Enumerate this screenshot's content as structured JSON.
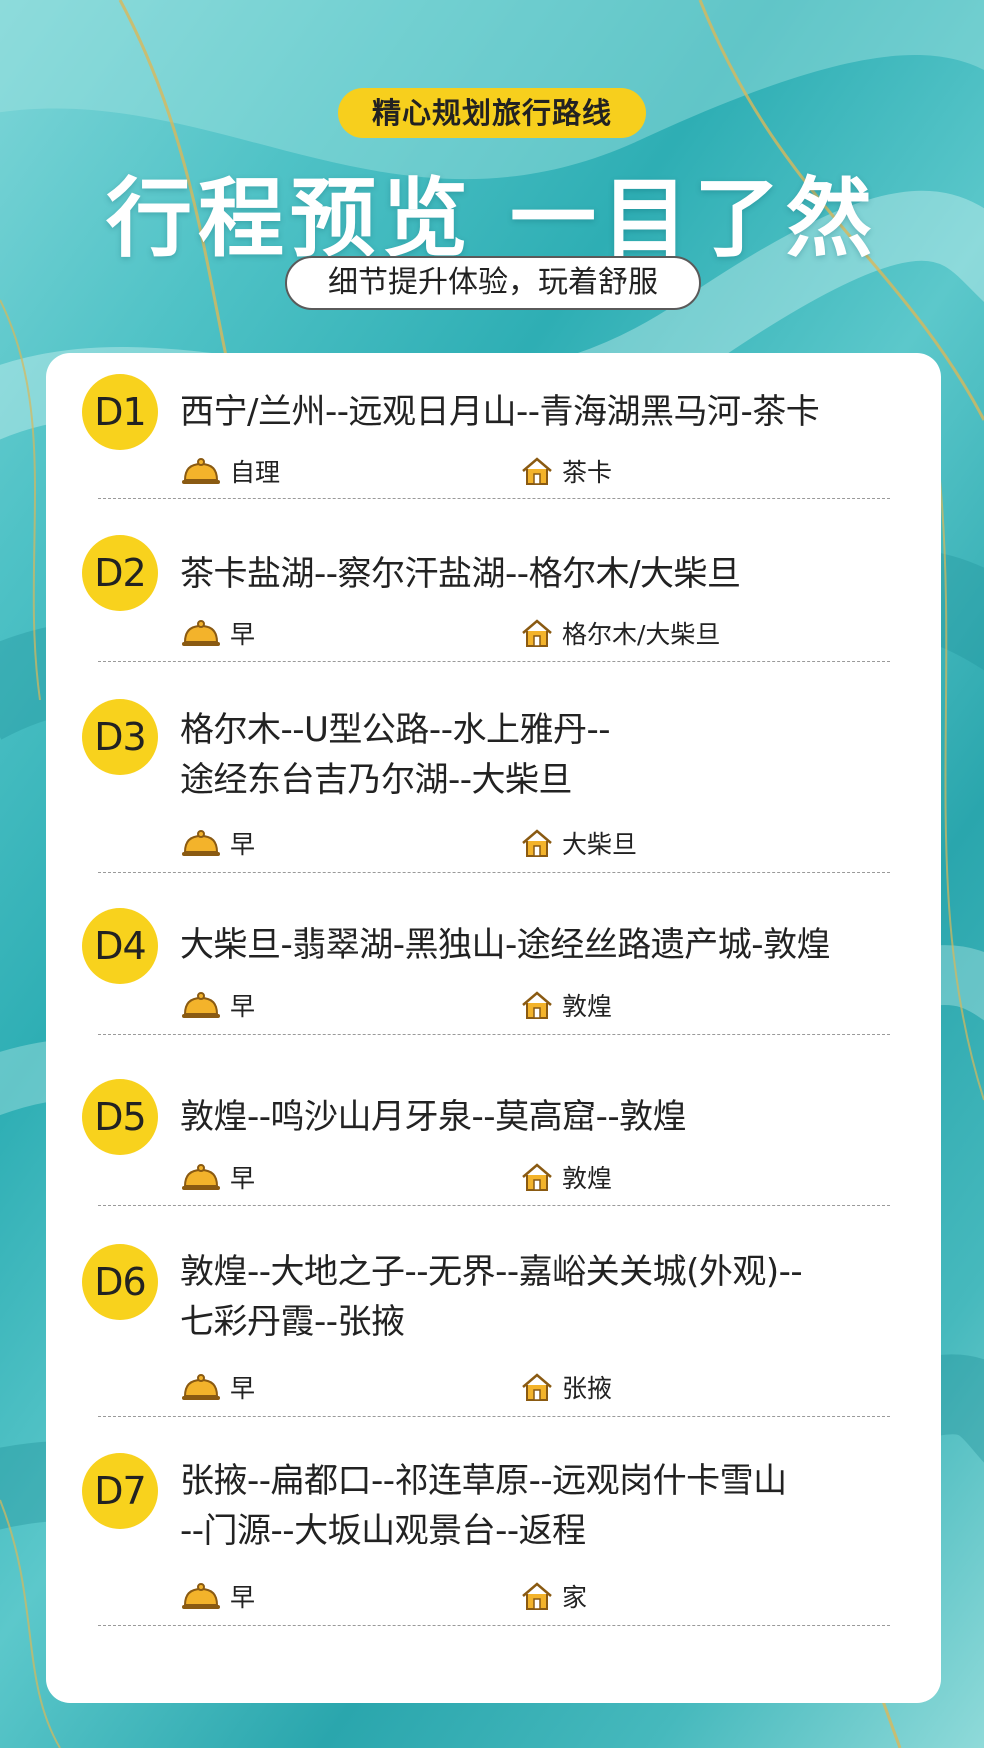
{
  "header": {
    "badge": "精心规划旅行路线",
    "headline": "行程预览 一目了然",
    "subtitle": "细节提升体验，玩着舒服"
  },
  "days": [
    {
      "label": "D1",
      "route": "西宁/兰州--远观日月山--青海湖黑马河-茶卡",
      "meal": "自理",
      "hotel": "茶卡"
    },
    {
      "label": "D2",
      "route": "茶卡盐湖--察尔汗盐湖--格尔木/大柴旦",
      "meal": "早",
      "hotel": "格尔木/大柴旦"
    },
    {
      "label": "D3",
      "route": "格尔木--U型公路--水上雅丹--\n途经东台吉乃尔湖--大柴旦",
      "meal": "早",
      "hotel": "大柴旦"
    },
    {
      "label": "D4",
      "route": "大柴旦-翡翠湖-黑独山-途经丝路遗产城-敦煌",
      "meal": "早",
      "hotel": "敦煌"
    },
    {
      "label": "D5",
      "route": "敦煌--鸣沙山月牙泉--莫高窟--敦煌",
      "meal": "早",
      "hotel": "敦煌"
    },
    {
      "label": "D6",
      "route": "敦煌--大地之子--无界--嘉峪关关城(外观)--\n七彩丹霞--张掖",
      "meal": "早",
      "hotel": "张掖"
    },
    {
      "label": "D7",
      "route": "张掖--扁都口--祁连草原--远观岗什卡雪山\n--门源--大坂山观景台--返程",
      "meal": "早",
      "hotel": "家"
    }
  ],
  "icons": {
    "meal": "meal-cloche-icon",
    "hotel": "house-icon"
  },
  "colors": {
    "accent": "#f8d21d",
    "background": "#2eaeb4"
  }
}
